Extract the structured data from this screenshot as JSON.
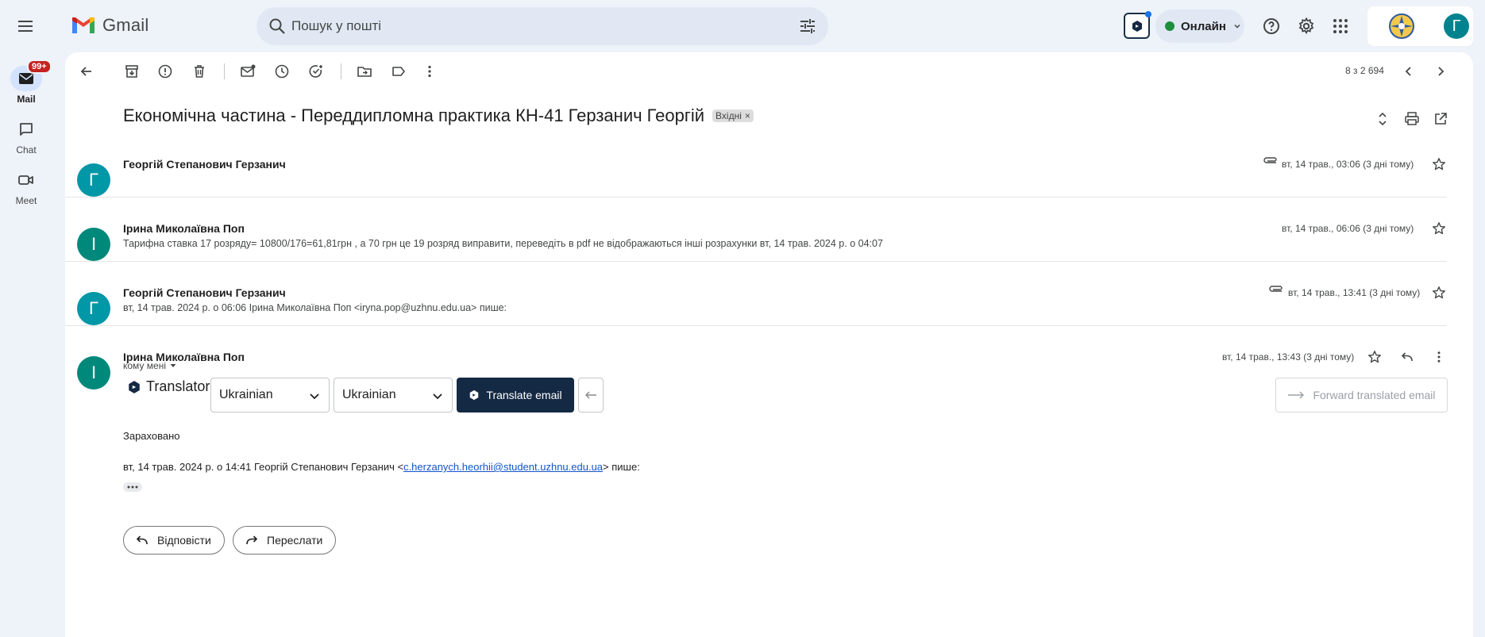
{
  "header": {
    "app_name": "Gmail",
    "search_placeholder": "Пошук у пошті",
    "status_label": "Онлайн",
    "account_initial": "Г"
  },
  "rail": {
    "mail_label": "Mail",
    "mail_badge": "99+",
    "chat_label": "Chat",
    "meet_label": "Meet"
  },
  "toolbar": {
    "pager": "8 з 2 694"
  },
  "thread": {
    "subject": "Економічна частина - Переддипломна практика КН-41 Герзанич Георгій",
    "label_chip": "Вхідні",
    "label_chip_close": "×"
  },
  "messages": [
    {
      "initial": "Г",
      "avatar_color": "#0097a7",
      "from": "Георгій Степанович Герзанич",
      "snippet": "",
      "date": "вт, 14 трав., 03:06 (3 дні тому)",
      "has_attachment": true
    },
    {
      "initial": "І",
      "avatar_color": "#00897b",
      "from": "Ірина Миколаївна Поп",
      "snippet": "Тарифна ставка 17 розряду= 10800/176=61,81грн , а 70 грн це 19 розряд виправити, переведіть в pdf не відображаються інші розрахунки вт, 14 трав. 2024 р. о 04:07",
      "date": "вт, 14 трав., 06:06 (3 дні тому)",
      "has_attachment": false
    },
    {
      "initial": "Г",
      "avatar_color": "#0097a7",
      "from": "Георгій Степанович Герзанич",
      "snippet": "вт, 14 трав. 2024 р. о 06:06 Ірина Миколаївна Поп <iryna.pop@uzhnu.edu.ua> пише:",
      "date": "вт, 14 трав., 13:41 (3 дні тому)",
      "has_attachment": true
    },
    {
      "initial": "І",
      "avatar_color": "#00897b",
      "from": "Ірина Миколаївна Поп",
      "to_line": "кому мені",
      "date": "вт, 14 трав., 13:43 (3 дні тому)",
      "body": "Зараховано",
      "quote_prefix": "вт, 14 трав. 2024 р. о 14:41 Георгій Степанович Герзанич <",
      "quote_email": "c.herzanych.heorhii@student.uzhnu.edu.ua",
      "quote_suffix": "> пише:"
    }
  ],
  "translator": {
    "label": "Translator",
    "source_lang": "Ukrainian",
    "target_lang": "Ukrainian",
    "translate_label": "Translate email",
    "forward_label": "Forward translated email"
  },
  "actions": {
    "reply_label": "Відповісти",
    "forward_label": "Переслати"
  }
}
